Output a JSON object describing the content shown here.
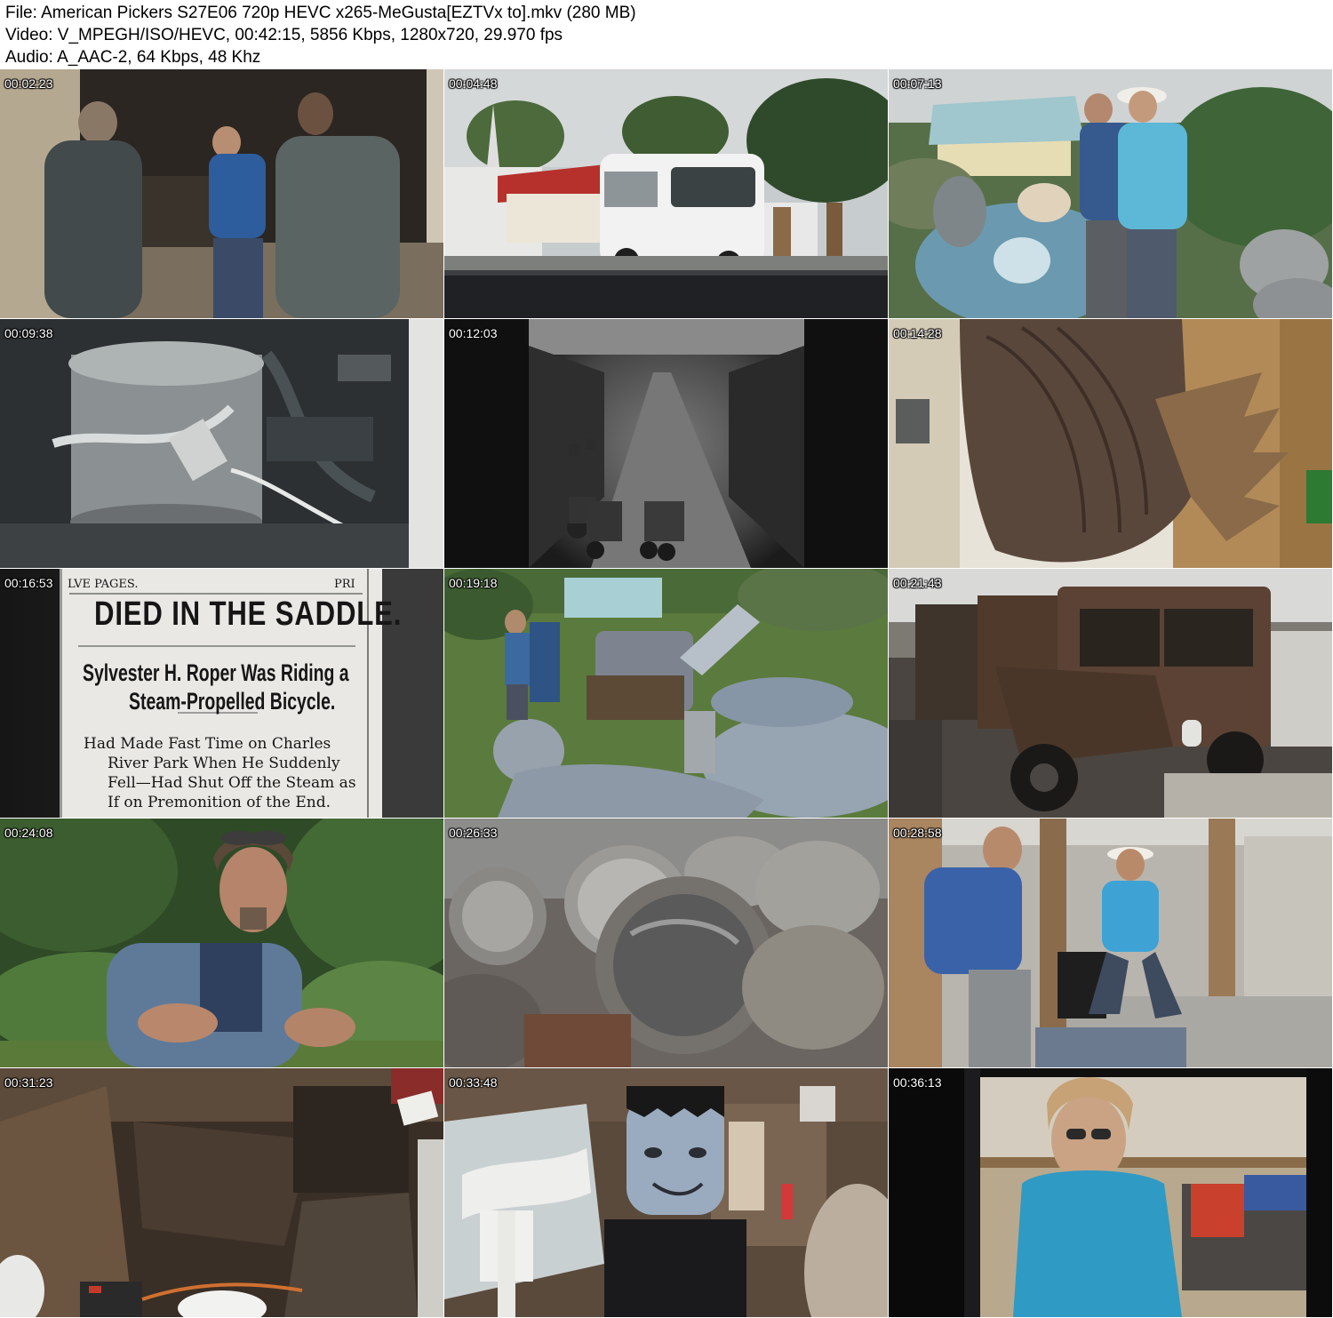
{
  "header": {
    "file_line": "File: American Pickers S27E06 720p HEVC x265-MeGusta[EZTVx to].mkv (280 MB)",
    "video_line": "Video: V_MPEGH/ISO/HEVC, 00:42:15, 5856 Kbps, 1280x720, 29.970 fps",
    "audio_line": "Audio: A_AAC-2, 64 Kbps, 48 Khz"
  },
  "thumbnails": [
    {
      "timestamp": "00:02:23",
      "scene": "garage-conversation"
    },
    {
      "timestamp": "00:04:48",
      "scene": "van-castle-roadside"
    },
    {
      "timestamp": "00:07:13",
      "scene": "statue-yard"
    },
    {
      "timestamp": "00:09:38",
      "scene": "engine-tank"
    },
    {
      "timestamp": "00:12:03",
      "scene": "archival-bicycles"
    },
    {
      "timestamp": "00:14:28",
      "scene": "carved-bird-closeup"
    },
    {
      "timestamp": "00:16:53",
      "scene": "newspaper-clipping"
    },
    {
      "timestamp": "00:19:18",
      "scene": "giant-statues-field"
    },
    {
      "timestamp": "00:21:43",
      "scene": "old-cars-barn"
    },
    {
      "timestamp": "00:24:08",
      "scene": "interview-forest"
    },
    {
      "timestamp": "00:26:33",
      "scene": "headlights-pile"
    },
    {
      "timestamp": "00:28:58",
      "scene": "workshop-gesture"
    },
    {
      "timestamp": "00:31:23",
      "scene": "vehicle-interior"
    },
    {
      "timestamp": "00:33:48",
      "scene": "frankenstein-figure"
    },
    {
      "timestamp": "00:36:13",
      "scene": "woman-in-window"
    }
  ],
  "newspaper": {
    "top_left": "LVE PAGES.",
    "top_right": "PRI",
    "headline": "DIED IN THE SADDLE.",
    "sub1": "Sylvester H. Roper Was Riding a",
    "sub2": "Steam-Propelled Bicycle.",
    "body1": "Had Made Fast Time on Charles",
    "body2": "River Park When He Suddenly",
    "body3": "Fell—Had Shut Off the Steam as",
    "body4": "If on Premonition of the End."
  },
  "colors": {
    "background": "#ffffff",
    "header_text": "#000000",
    "timestamp_text": "#ffffff"
  }
}
